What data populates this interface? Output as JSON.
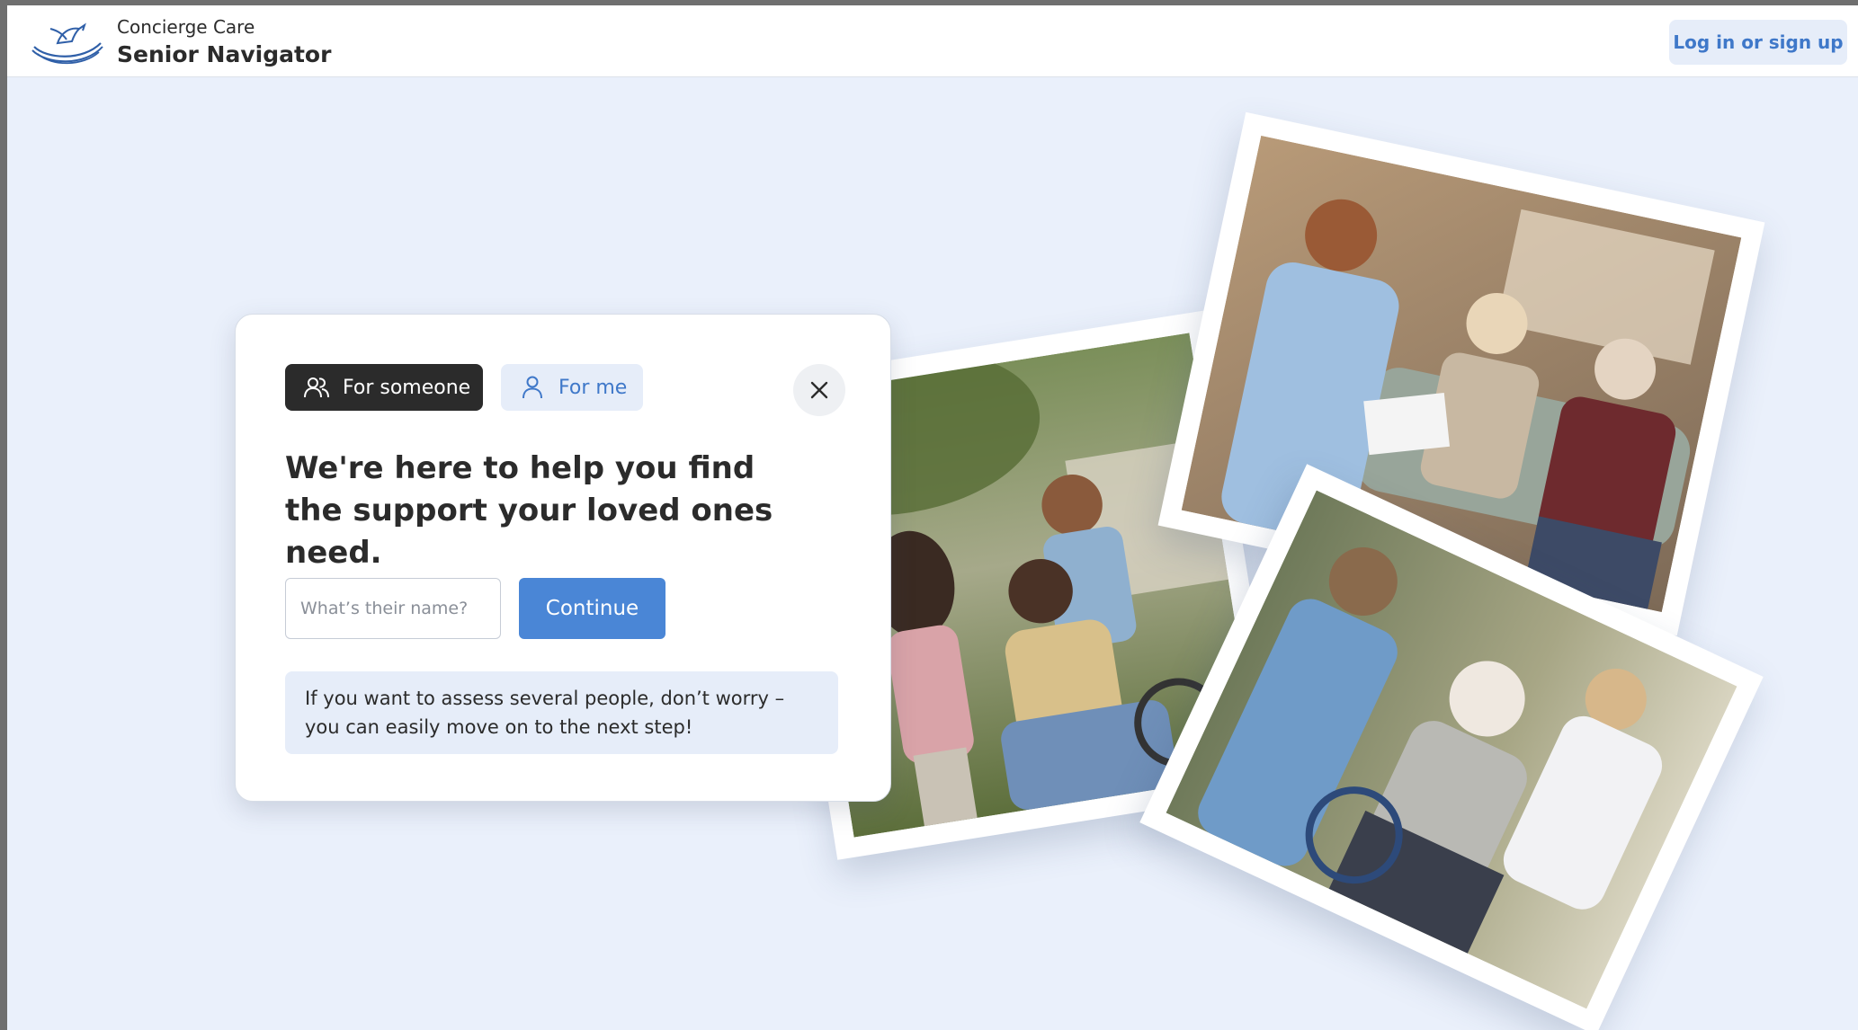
{
  "header": {
    "brand_small": "Concierge Care",
    "brand_big": "Senior Navigator",
    "login_label": "Log in or sign up",
    "logo_icon": "dove-nest-icon"
  },
  "card": {
    "tabs": [
      {
        "label": "For someone",
        "icon": "people-icon",
        "active": true
      },
      {
        "label": "For me",
        "icon": "person-icon",
        "active": false
      }
    ],
    "close_icon": "close-icon",
    "headline": "We're here to help you find the support your loved ones need.",
    "name_input": {
      "placeholder": "What’s their name?",
      "value": ""
    },
    "continue_label": "Continue",
    "info_text": "If you want to assess several people, don’t worry – you can easily move on to the next step!"
  },
  "colors": {
    "accent": "#4a86d6",
    "accent_light": "#e6edf9",
    "dark": "#2b2b2b",
    "page_bg": "#eaf0fb"
  }
}
